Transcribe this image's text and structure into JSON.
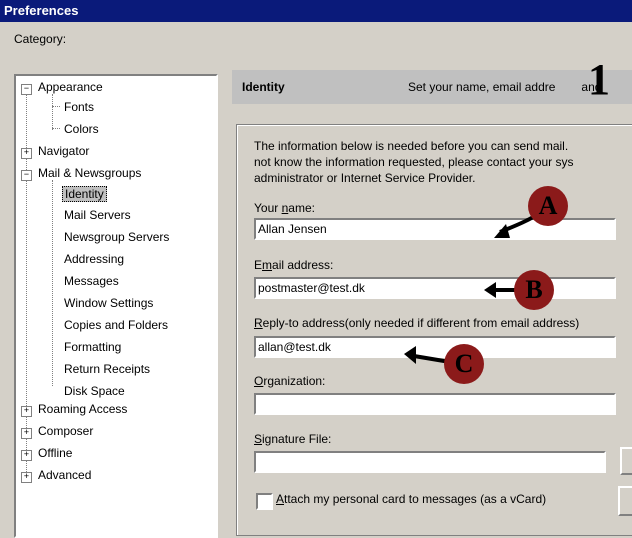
{
  "window": {
    "title": "Preferences"
  },
  "category_label": "Category:",
  "tree": {
    "items": [
      {
        "label": "Appearance",
        "expander": "−"
      },
      {
        "label": "Fonts"
      },
      {
        "label": "Colors"
      },
      {
        "label": "Navigator",
        "expander": "+"
      },
      {
        "label": "Mail & Newsgroups",
        "expander": "−"
      },
      {
        "label": "Identity",
        "selected": true
      },
      {
        "label": "Mail Servers"
      },
      {
        "label": "Newsgroup Servers"
      },
      {
        "label": "Addressing"
      },
      {
        "label": "Messages"
      },
      {
        "label": "Window Settings"
      },
      {
        "label": "Copies and Folders"
      },
      {
        "label": "Formatting"
      },
      {
        "label": "Return Receipts"
      },
      {
        "label": "Disk Space"
      },
      {
        "label": "Roaming Access",
        "expander": "+"
      },
      {
        "label": "Composer",
        "expander": "+"
      },
      {
        "label": "Offline",
        "expander": "+"
      },
      {
        "label": "Advanced",
        "expander": "+"
      }
    ]
  },
  "panel": {
    "title": "Identity",
    "description": "Set your name, email addre",
    "description_tail": "and"
  },
  "info": {
    "line1": "The information below is needed before you can send mail.",
    "line2": "not know the information requested, please contact your sys",
    "line3": "administrator or Internet Service Provider."
  },
  "fields": {
    "name": {
      "label_pre": "Your ",
      "label_ul": "n",
      "label_post": "ame:",
      "value": "Allan Jensen"
    },
    "email": {
      "label_pre": "E",
      "label_ul": "m",
      "label_post": "ail address:",
      "value": "postmaster@test.dk"
    },
    "reply": {
      "label_pre": "",
      "label_ul": "R",
      "label_post": "eply-to address(only needed if different from email address)",
      "value": "allan@test.dk"
    },
    "org": {
      "label_pre": "",
      "label_ul": "O",
      "label_post": "rganization:",
      "value": ""
    },
    "sig": {
      "label_pre": "",
      "label_ul": "S",
      "label_post": "ignature File:",
      "value": ""
    }
  },
  "vcard": {
    "label_pre": "",
    "label_ul": "A",
    "label_post": "ttach my personal card to messages (as a vCard)",
    "checked": false
  },
  "callouts": {
    "a": "A",
    "b": "B",
    "c": "C",
    "i": "1"
  },
  "colors": {
    "titlebar": "#0a1a7a",
    "callout": "#8b1a1a",
    "panel_bg": "#d4d0c8"
  }
}
